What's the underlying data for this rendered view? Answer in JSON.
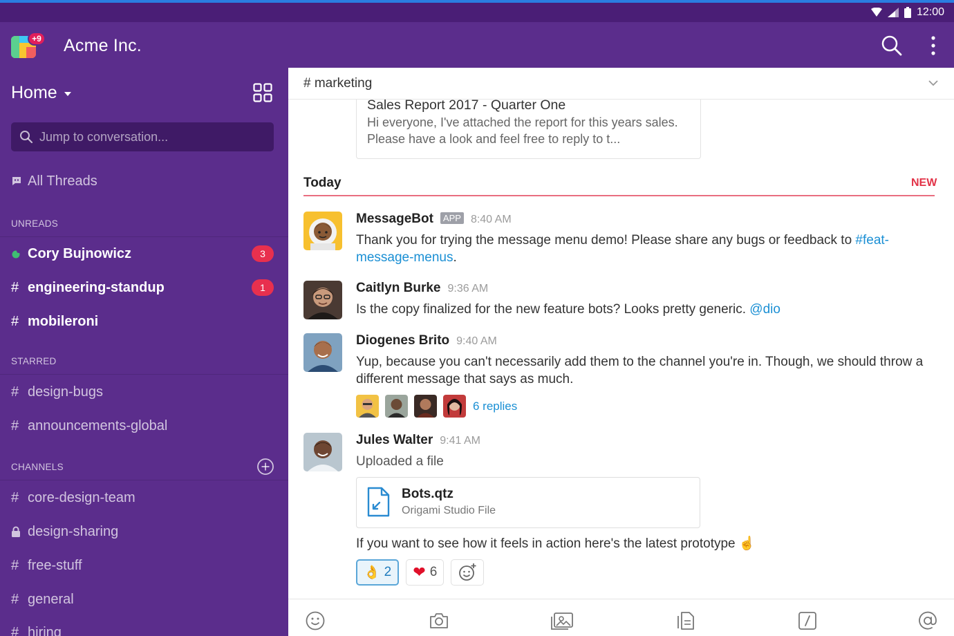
{
  "status_bar": {
    "time": "12:00"
  },
  "app_bar": {
    "workspace_name": "Acme Inc.",
    "logo_badge": "+9"
  },
  "sidebar": {
    "home_label": "Home",
    "jump_placeholder": "Jump to conversation...",
    "all_threads": "All Threads",
    "sections": {
      "unreads": "UNREADS",
      "starred": "STARRED",
      "channels": "CHANNELS"
    },
    "unreads": [
      {
        "name": "Cory Bujnowicz",
        "count": "3"
      },
      {
        "name": "engineering-standup",
        "count": "1"
      },
      {
        "name": "mobileroni"
      }
    ],
    "starred": [
      {
        "name": "design-bugs"
      },
      {
        "name": "announcements-global"
      }
    ],
    "channels": [
      {
        "name": "core-design-team"
      },
      {
        "name": "design-sharing"
      },
      {
        "name": "free-stuff"
      },
      {
        "name": "general"
      },
      {
        "name": "hiring"
      }
    ],
    "prefix_hash": "#"
  },
  "channel": {
    "name": "# marketing"
  },
  "earlier_attachment": {
    "title": "Sales Report 2017 - Quarter One",
    "description": "Hi everyone, I've attached the report for this years sales. Please have a look and feel free to reply to t..."
  },
  "divider": {
    "label": "Today",
    "new_label": "NEW"
  },
  "messages": [
    {
      "user": "MessageBot",
      "tag": "APP",
      "time": "8:40 AM",
      "text": "Thank you for trying the message menu demo! Please share any bugs or feedback to ",
      "link": "#feat-message-menus",
      "suffix": "."
    },
    {
      "user": "Caitlyn Burke",
      "time": "9:36 AM",
      "text": "Is the copy finalized for the new feature bots? Looks pretty generic. ",
      "mention": "@dio"
    },
    {
      "user": "Diogenes Brito",
      "time": "9:40 AM",
      "text": "Yup, because you can't necessarily add them to the channel you're in. Though, we should throw a different message that says as much.",
      "replies": "6 replies"
    },
    {
      "user": "Jules Walter",
      "time": "9:41 AM",
      "text": "Uploaded a file",
      "file": {
        "name": "Bots.qtz",
        "type": "Origami Studio File"
      },
      "followup": "If you want to see how it feels in action here's the latest prototype ",
      "followup_emoji": "☝",
      "reactions": [
        {
          "emoji": "👌",
          "count": "2"
        },
        {
          "emoji": "❤",
          "count": "6"
        }
      ]
    }
  ],
  "colors": {
    "sidebar": "#5b2d8c",
    "status_bar": "#4a1e76",
    "badge": "#e8304e",
    "link": "#1a8fd4",
    "new": "#e23348"
  },
  "icons": {
    "app_bar": [
      "search-icon",
      "more-vertical-icon"
    ],
    "composer": [
      "emoji-icon",
      "camera-icon",
      "gallery-icon",
      "file-icon",
      "slash-command-icon",
      "mention-icon"
    ]
  }
}
